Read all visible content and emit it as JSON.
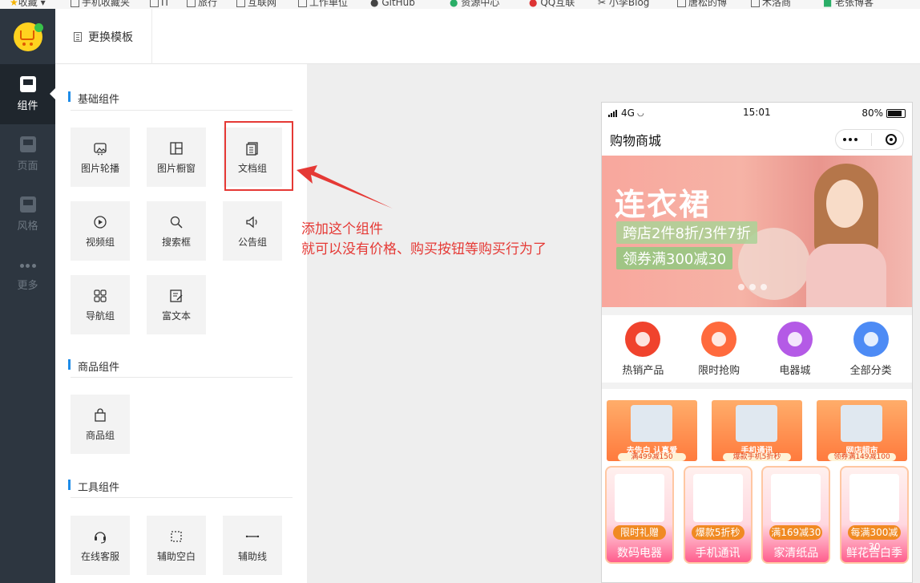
{
  "bookmarks": [
    {
      "label": "收藏"
    },
    {
      "label": "手机收藏夹"
    },
    {
      "label": "IT"
    },
    {
      "label": "旅行"
    },
    {
      "label": "互联网"
    },
    {
      "label": "工作单位"
    },
    {
      "label": "GitHub"
    },
    {
      "label": "资源中心"
    },
    {
      "label": "QQ互联"
    },
    {
      "label": "小李Blog"
    },
    {
      "label": "唐松的博"
    },
    {
      "label": "木洛商"
    },
    {
      "label": "老张博客"
    }
  ],
  "rail": {
    "items": [
      {
        "label": "组件",
        "icon": "component-icon"
      },
      {
        "label": "页面",
        "icon": "page-icon"
      },
      {
        "label": "风格",
        "icon": "style-icon"
      },
      {
        "label": "更多",
        "icon": "more-icon"
      }
    ]
  },
  "topbar": {
    "change_template_label": "更换模板"
  },
  "panel": {
    "basic": {
      "title": "基础组件",
      "items": [
        {
          "label": "图片轮播",
          "icon": "image-carousel-icon"
        },
        {
          "label": "图片橱窗",
          "icon": "image-window-icon"
        },
        {
          "label": "文档组",
          "icon": "document-icon"
        },
        {
          "label": "视频组",
          "icon": "video-icon"
        },
        {
          "label": "搜索框",
          "icon": "search-icon"
        },
        {
          "label": "公告组",
          "icon": "notice-icon"
        },
        {
          "label": "导航组",
          "icon": "nav-icon"
        },
        {
          "label": "富文本",
          "icon": "richtext-icon"
        }
      ]
    },
    "goods": {
      "title": "商品组件",
      "items": [
        {
          "label": "商品组",
          "icon": "shopping-bag-icon"
        }
      ]
    },
    "tools": {
      "title": "工具组件",
      "items": [
        {
          "label": "在线客服",
          "icon": "headset-icon"
        },
        {
          "label": "辅助空白",
          "icon": "blank-icon"
        },
        {
          "label": "辅助线",
          "icon": "line-icon"
        }
      ]
    }
  },
  "annotation": {
    "line1": "添加这个组件",
    "line2": "就可以没有价格、购买按钮等购买行为了",
    "color": "#e53935"
  },
  "phone": {
    "status": {
      "network": "4G",
      "time": "15:01",
      "battery": "80%"
    },
    "title": "购物商城",
    "banner": {
      "headline": "连衣裙",
      "promo1": "跨店2件8折/3件7折",
      "promo2": "领券满300减30"
    },
    "categories": [
      {
        "label": "热销产品",
        "color": "#f0432d"
      },
      {
        "label": "限时抢购",
        "color": "#ff6a3d"
      },
      {
        "label": "电器城",
        "color": "#b45ae6"
      },
      {
        "label": "全部分类",
        "color": "#4d8bf5"
      }
    ],
    "promos": [
      {
        "title": "去告白 认真爱",
        "sub": "满499减150"
      },
      {
        "title": "手机通讯",
        "sub": "爆款手机5折秒"
      },
      {
        "title": "网店超市",
        "sub": "领券满149减100"
      }
    ],
    "cards": [
      {
        "tag": "限时礼赠",
        "name": "数码电器"
      },
      {
        "tag": "爆款5折秒",
        "name": "手机通讯"
      },
      {
        "tag": "满169减30",
        "name": "家清纸品"
      },
      {
        "tag": "每满300减30",
        "name": "鲜花告白季"
      }
    ]
  },
  "colors": {
    "accent": "#1e8ce8",
    "rail_bg": "#2d3640",
    "highlight": "#e53935"
  }
}
